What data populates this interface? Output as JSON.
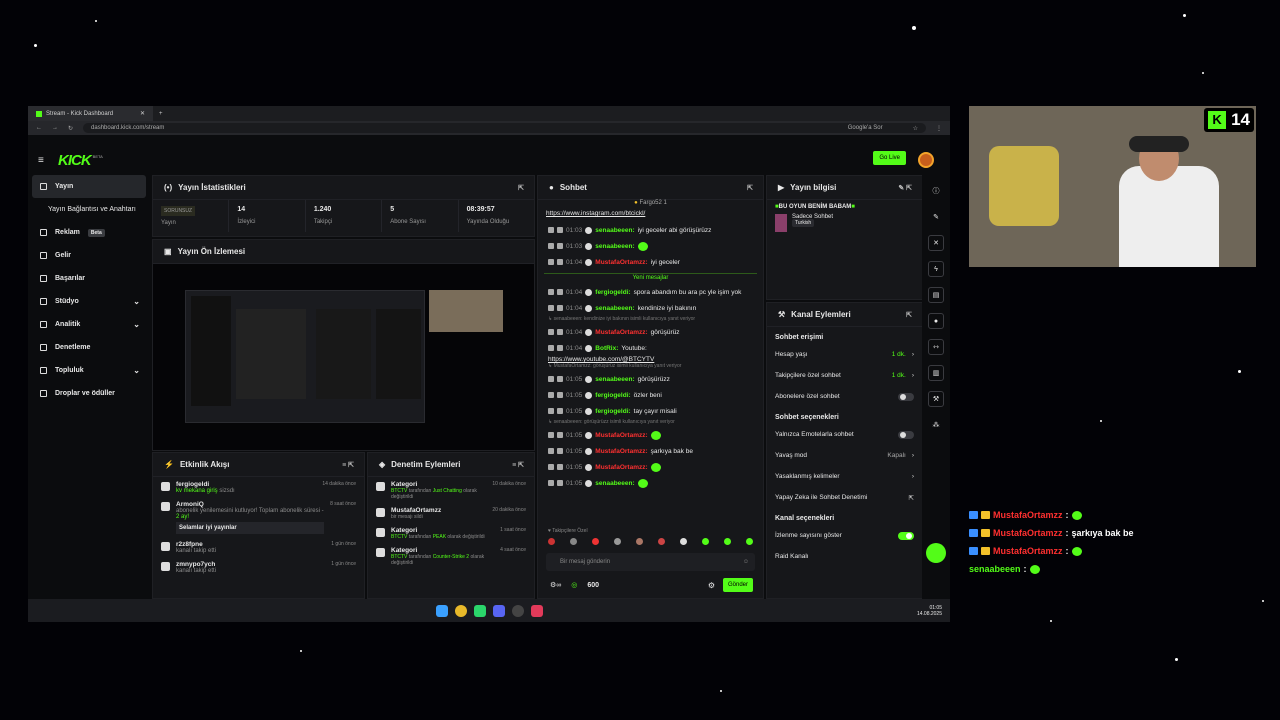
{
  "browser": {
    "tab_title": "Stream - Kick Dashboard",
    "url": "dashboard.kick.com/stream",
    "google_btn": "Google'a Sor"
  },
  "header": {
    "logo": "KICK",
    "logo_badge": "BETA",
    "go_live": "Go Live"
  },
  "sidebar": {
    "items": [
      {
        "label": "Yayın"
      },
      {
        "label": "Yayın Bağlantısı ve Anahtarı"
      },
      {
        "label": "Reklam",
        "badge": "Beta"
      },
      {
        "label": "Gelir"
      },
      {
        "label": "Başarılar"
      },
      {
        "label": "Stüdyo"
      },
      {
        "label": "Analitik"
      },
      {
        "label": "Denetleme"
      },
      {
        "label": "Topluluk"
      },
      {
        "label": "Droplar ve ödüller"
      }
    ]
  },
  "stats": {
    "title": "Yayın İstatistikleri",
    "items": [
      {
        "value": "SORUNSUZ",
        "label": "Yayın"
      },
      {
        "value": "14",
        "label": "İzleyici"
      },
      {
        "value": "1.240",
        "label": "Takipçi"
      },
      {
        "value": "5",
        "label": "Abone Sayısı"
      },
      {
        "value": "08:39:57",
        "label": "Yayında Olduğu"
      }
    ]
  },
  "preview": {
    "title": "Yayın Ön İzlemesi"
  },
  "activity": {
    "title": "Etkinlik Akışı",
    "items": [
      {
        "user": "fergiogeldi",
        "text": "kv mekana giriş",
        "text2": " sizsdı",
        "time": "14 dakika önce"
      },
      {
        "user": "ArmoniQ",
        "text": "abonelik yenilemesini kutluyor! Toplam abonelik süresi - ",
        "bold": "2 ay!",
        "time": "8 saat önce",
        "reply": "Selamlar iyi yayınlar"
      },
      {
        "user": "r2z8fpne",
        "text": "kanalı takip etti",
        "time": "1 gün önce"
      },
      {
        "user": "zmnypo7ych",
        "text": "kanalı takip etti",
        "time": "1 gün önce"
      }
    ]
  },
  "mod": {
    "title": "Denetim Eylemleri",
    "items": [
      {
        "title": "Kategori",
        "who": "BTCTV",
        "mid": " tarafından ",
        "val": "Just Chatting",
        "tail": " olarak değiştirildi",
        "time": "10 dakika önce"
      },
      {
        "title": "MustafaOrtamzz",
        "text": "bir mesajı sildi",
        "time": "20 dakika önce"
      },
      {
        "title": "Kategori",
        "who": "BTCTV",
        "mid": " tarafından ",
        "val": "PEAK",
        "tail": " olarak değiştirildi",
        "time": "1 saat önce"
      },
      {
        "title": "Kategori",
        "who": "BTCTV",
        "mid": " tarafından ",
        "val": "Counter-Strike 2",
        "tail": " olarak değiştirildi",
        "time": "4 saat önce"
      }
    ]
  },
  "chat": {
    "title": "Sohbet",
    "pinned_user": "Fargo52",
    "pinned_count": "1",
    "link1": "https://www.instagram.com/btcickl/",
    "messages": [
      {
        "time": "01:03",
        "user": "senaabeeen",
        "color": "#53fc18",
        "text": "iyi geceler abi görüşürüzz"
      },
      {
        "time": "01:03",
        "user": "senaabeeen",
        "color": "#53fc18",
        "text": "",
        "emote": true
      },
      {
        "time": "01:04",
        "user": "MustafaOrtamzz",
        "color": "#ff3030",
        "text": "iyi geceler"
      }
    ],
    "new_label": "Yeni mesajlar",
    "messages2": [
      {
        "time": "01:04",
        "user": "fergiogeldi",
        "color": "#53fc18",
        "text": "spora abandım bu ara pc yle işim yok"
      },
      {
        "time": "01:04",
        "user": "senaabeeen",
        "color": "#53fc18",
        "text": "kendinize iyi bakının"
      },
      {
        "reply": "senaabeeen: kendinize iyi bakının isimli kullanıcıya yanıt veriyor"
      },
      {
        "time": "01:04",
        "user": "MustafaOrtamzz",
        "color": "#ff3030",
        "text": "görüşürüz"
      },
      {
        "time": "01:04",
        "user": "BotRix",
        "color": "#53fc18",
        "text": "Youtube:",
        "link": "https://www.youtube.com/@BTCYTV"
      },
      {
        "reply": "MustafaOrtamzz: görüşürüz isimli kullanıcıya yanıt veriyor"
      },
      {
        "time": "01:05",
        "user": "senaabeeen",
        "color": "#53fc18",
        "text": "görüşürüzz"
      },
      {
        "time": "01:05",
        "user": "fergiogeldi",
        "color": "#53fc18",
        "text": "özler beni"
      },
      {
        "time": "01:05",
        "user": "fergiogeldi",
        "color": "#53fc18",
        "text": "tay çayır misali"
      },
      {
        "reply": "senaabeeen: görüşürüzz isimli kullanıcıya yanıt veriyor"
      },
      {
        "time": "01:05",
        "user": "MustafaOrtamzz",
        "color": "#ff3030",
        "text": "",
        "emote": true
      },
      {
        "time": "01:05",
        "user": "MustafaOrtamzz",
        "color": "#ff3030",
        "text": "şarkıya bak be"
      },
      {
        "time": "01:05",
        "user": "MustafaOrtamzz",
        "color": "#ff3030",
        "text": "",
        "emote": true
      },
      {
        "time": "01:05",
        "user": "senaabeeen",
        "color": "#53fc18",
        "text": "",
        "emote": true
      }
    ],
    "followers_only": "Takipçilere Özel",
    "placeholder": "Bir mesaj gönderin",
    "points": "600",
    "send": "Gönder"
  },
  "streaminfo": {
    "title": "Yayın bilgisi",
    "stream_title": "BU OYUN BENİM BABAM",
    "category": "Sadece Sohbet",
    "lang": "Turkish"
  },
  "channel": {
    "title": "Kanal Eylemleri",
    "sec1": "Sohbet erişimi",
    "rows1": [
      {
        "label": "Hesap yaşı",
        "val": "1 dk."
      },
      {
        "label": "Takipçilere özel sohbet",
        "val": "1 dk."
      },
      {
        "label": "Abonelere özel sohbet"
      }
    ],
    "sec2": "Sohbet seçenekleri",
    "rows2": [
      {
        "label": "Yalnızca Emotelarla sohbet"
      },
      {
        "label": "Yavaş mod",
        "val": "Kapalı"
      },
      {
        "label": "Yasaklanmış kelimeler"
      },
      {
        "label": "Yapay Zeka ile Sohbet Denetimi"
      }
    ],
    "sec3": "Kanal seçenekleri",
    "rows3": [
      {
        "label": "İzlenme sayısını göster"
      },
      {
        "label": "Raid Kanalı"
      }
    ]
  },
  "taskbar": {
    "time": "01:05",
    "date": "14.08.2025"
  },
  "webcam": {
    "viewers": "14"
  },
  "overlay": [
    {
      "user": "MustafaOrtamzz",
      "color": "#ff3030",
      "text": ""
    },
    {
      "user": "MustafaOrtamzz",
      "color": "#ff3030",
      "text": "şarkıya bak be"
    },
    {
      "user": "MustafaOrtamzz",
      "color": "#ff3030",
      "text": ""
    },
    {
      "user": "senaabeeen",
      "color": "#53fc18",
      "text": ""
    }
  ]
}
